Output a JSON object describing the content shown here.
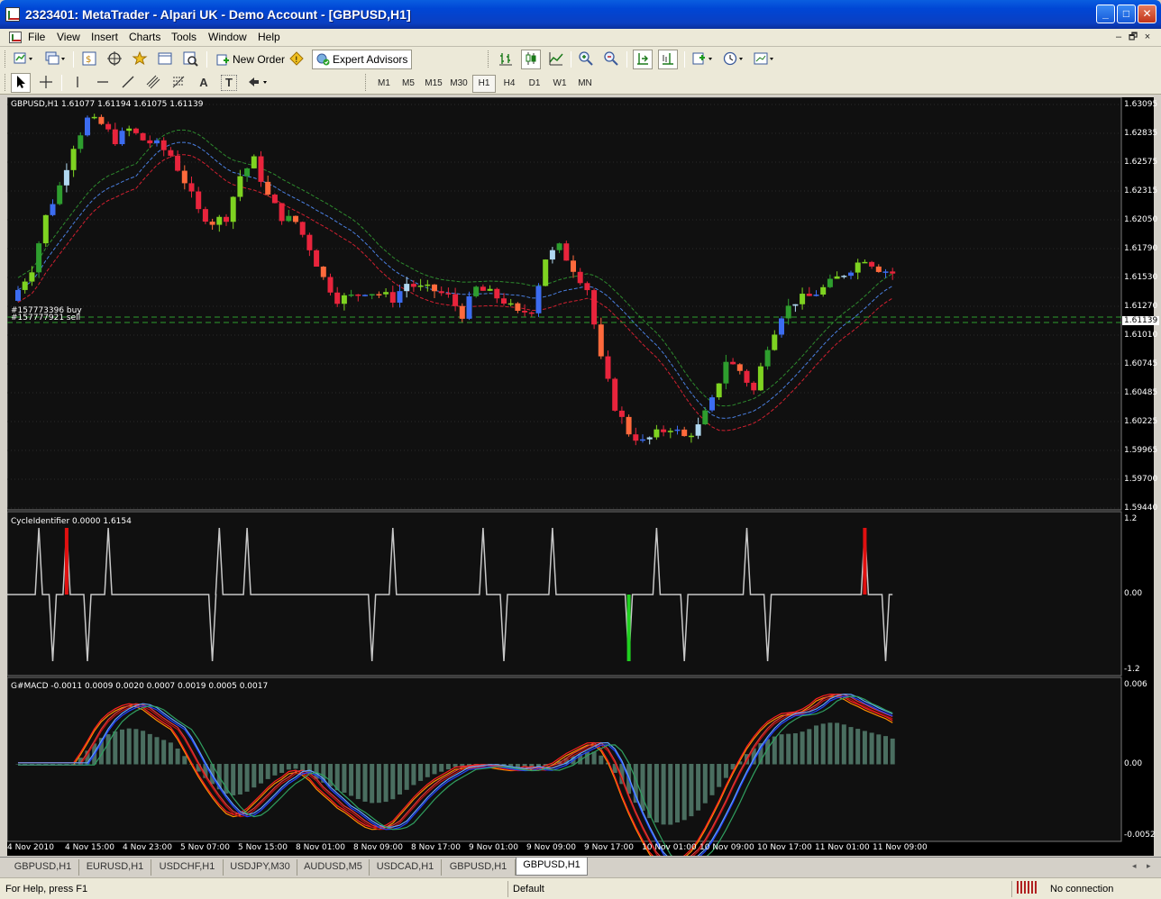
{
  "window": {
    "title": "2323401: MetaTrader - Alpari UK - Demo Account - [GBPUSD,H1]",
    "minimize": "_",
    "maximize": "□",
    "close": "✕"
  },
  "menu": {
    "items": [
      "File",
      "View",
      "Insert",
      "Charts",
      "Tools",
      "Window",
      "Help"
    ],
    "mdi_minimize": "–",
    "mdi_restore": "🗗",
    "mdi_close": "×"
  },
  "toolbar": {
    "new_order": "New Order",
    "expert_advisors": "Expert Advisors",
    "icons": [
      "new-chart-icon",
      "profiles-icon",
      "market-watch-icon",
      "navigator-icon",
      "favorites-icon",
      "terminal-icon",
      "strategy-tester-icon",
      "new-order-icon",
      "metaeditor-icon",
      "expert-advisors-icon",
      "bar-chart-icon",
      "candlesticks-icon",
      "line-chart-icon",
      "zoom-in-icon",
      "zoom-out-icon",
      "auto-scroll-icon",
      "chart-shift-icon",
      "indicators-icon",
      "periods-icon",
      "templates-icon"
    ]
  },
  "toolbar2": {
    "tools": [
      "cursor-icon",
      "crosshair-icon",
      "vertical-line-icon",
      "horizontal-line-icon",
      "trendline-icon",
      "equidistant-channel-icon",
      "fibonacci-icon",
      "text-icon",
      "text-label-icon",
      "arrows-icon"
    ],
    "text_tool": "A",
    "label_tool": "T",
    "timeframes": [
      "M1",
      "M5",
      "M15",
      "M30",
      "H1",
      "H4",
      "D1",
      "W1",
      "MN"
    ],
    "active_timeframe": "H1"
  },
  "chart": {
    "main_label": "GBPUSD,H1  1.61077 1.61194 1.61075 1.61139",
    "price_ticks": [
      "1.63095",
      "1.62835",
      "1.62575",
      "1.62315",
      "1.62050",
      "1.61790",
      "1.61530",
      "1.61270",
      "1.61010",
      "1.60745",
      "1.60485",
      "1.60225",
      "1.59965",
      "1.59700",
      "1.59440"
    ],
    "current_price": "1.61139",
    "order_buy": "#157773396 buy",
    "order_sell": "#157777921 sell",
    "cycle_label": "CycleIdentifier 0.0000 1.6154",
    "cycle_ticks": [
      "1.2",
      "0.00",
      "-1.2"
    ],
    "macd_label": "G#MACD -0.0011 0.0009 0.0020 0.0007 0.0019 0.0005 0.0017",
    "macd_ticks": [
      "0.006",
      "0.00",
      "-0.0052"
    ],
    "time_ticks": [
      "4 Nov 2010",
      "4 Nov 15:00",
      "4 Nov 23:00",
      "5 Nov 07:00",
      "5 Nov 15:00",
      "8 Nov 01:00",
      "8 Nov 09:00",
      "8 Nov 17:00",
      "9 Nov 01:00",
      "9 Nov 09:00",
      "9 Nov 17:00",
      "10 Nov 01:00",
      "10 Nov 09:00",
      "10 Nov 17:00",
      "11 Nov 01:00",
      "11 Nov 09:00"
    ],
    "colors": {
      "background": "#000000",
      "bull": "#7ed321",
      "bull_dark": "#2e9e2e",
      "bear": "#e8243c",
      "bear_orange": "#ff6a3c",
      "blue_candle": "#3c6cf0",
      "light_candle": "#b0d8f0",
      "envelope_upper": "#2e8b2e",
      "envelope_mid": "#4a7fe0",
      "envelope_lower": "#d02030",
      "order_line": "#2e9e2e"
    }
  },
  "tabs": {
    "items": [
      "GBPUSD,H1",
      "EURUSD,H1",
      "USDCHF,H1",
      "USDJPY,M30",
      "AUDUSD,M5",
      "USDCAD,H1",
      "GBPUSD,H1",
      "GBPUSD,H1"
    ],
    "active_index": 7,
    "left_arrow": "◂",
    "right_arrow": "▸"
  },
  "status": {
    "help": "For Help, press F1",
    "profile": "Default",
    "connection": "No connection"
  }
}
